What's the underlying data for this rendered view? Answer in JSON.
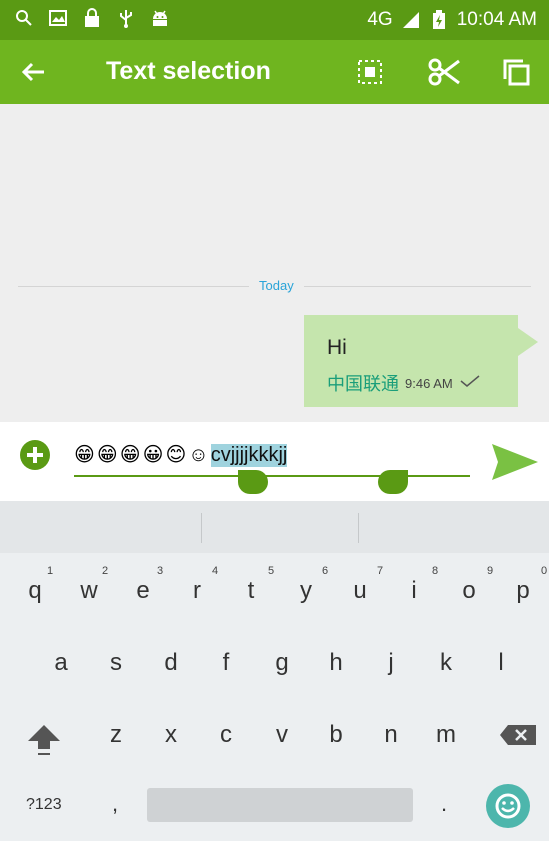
{
  "status_bar": {
    "network": "4G",
    "time": "10:04 AM",
    "left_icons": [
      "search-icon",
      "image-icon",
      "lock-icon",
      "usb-icon",
      "android-icon"
    ]
  },
  "action_bar": {
    "title": "Text selection",
    "actions": [
      "select-all-icon",
      "cut-icon",
      "copy-icon"
    ],
    "color": "#6fb51f"
  },
  "conversation": {
    "day_label": "Today",
    "message": {
      "text": "Hi",
      "carrier": "中国联通",
      "time": "9:46 AM",
      "status": "sent"
    }
  },
  "compose": {
    "emojis": [
      "😁",
      "😁",
      "😁",
      "😀",
      "😊",
      "☺"
    ],
    "text_before": "",
    "selected_text": "cvjjjjkkkjj"
  },
  "keyboard": {
    "row1": [
      "q",
      "w",
      "e",
      "r",
      "t",
      "y",
      "u",
      "i",
      "o",
      "p"
    ],
    "row1_hints": [
      "1",
      "2",
      "3",
      "4",
      "5",
      "6",
      "7",
      "8",
      "9",
      "0"
    ],
    "row2": [
      "a",
      "s",
      "d",
      "f",
      "g",
      "h",
      "j",
      "k",
      "l"
    ],
    "row3": [
      "z",
      "x",
      "c",
      "v",
      "b",
      "n",
      "m"
    ],
    "symbols_label": "?123",
    "comma": ",",
    "period": "."
  }
}
